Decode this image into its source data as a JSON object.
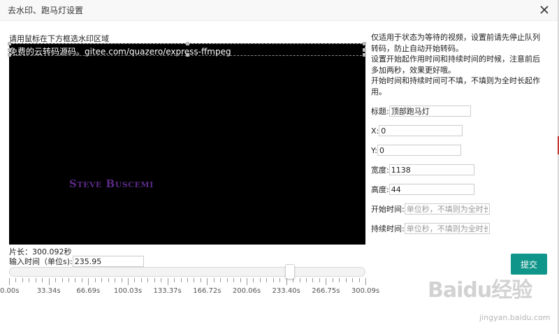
{
  "window": {
    "title": "去水印、跑马灯设置",
    "close_icon": "close-icon"
  },
  "video_panel": {
    "hint": "请用鼠标在下方框选水印区域",
    "overlay_text": "免费的云转码源码。gitee.com/quazero/express-ffmpeg",
    "watermark_text": "Steve Buscemi",
    "background": "#000000"
  },
  "timeline": {
    "duration_label": "片长：300.092秒",
    "time_input_label": "输入时间（单位s):",
    "time_input_value": "235.95",
    "slider_max": 300.09,
    "slider_value": 235.95,
    "tick_labels": [
      "0.00s",
      "33.34s",
      "66.69s",
      "100.03s",
      "133.37s",
      "166.72s",
      "200.06s",
      "233.40s",
      "266.75s",
      "300.09s"
    ]
  },
  "notes": [
    "仅适用于状态为等待的视频，设置前请先停止队列转码，防止自动开始转码。",
    "设置开始起作用时间和持续时间的时候，注意前后多加两秒，效果更好哦。",
    "开始时间和持续时间可不填，不填则为全时长起作用。"
  ],
  "form": {
    "title_label": "标题:",
    "title_value": "顶部跑马灯",
    "x_label": "X:",
    "x_value": "0",
    "y_label": "Y:",
    "y_value": "0",
    "width_label": "宽度:",
    "width_value": "1138",
    "height_label": "高度:",
    "height_value": "44",
    "start_label": "开始时间:",
    "start_placeholder": "单位秒，不填则为全时长",
    "duration_label": "持续时间:",
    "duration_placeholder": "单位秒，不填则为全时长",
    "submit_label": "提交"
  },
  "brand_watermark": {
    "logo": "Baidu经验",
    "url": "jingyan.baidu.com"
  },
  "colors": {
    "accent": "#10958a",
    "overlay_text": "#ffffff",
    "watermark": "#5b2a86"
  }
}
